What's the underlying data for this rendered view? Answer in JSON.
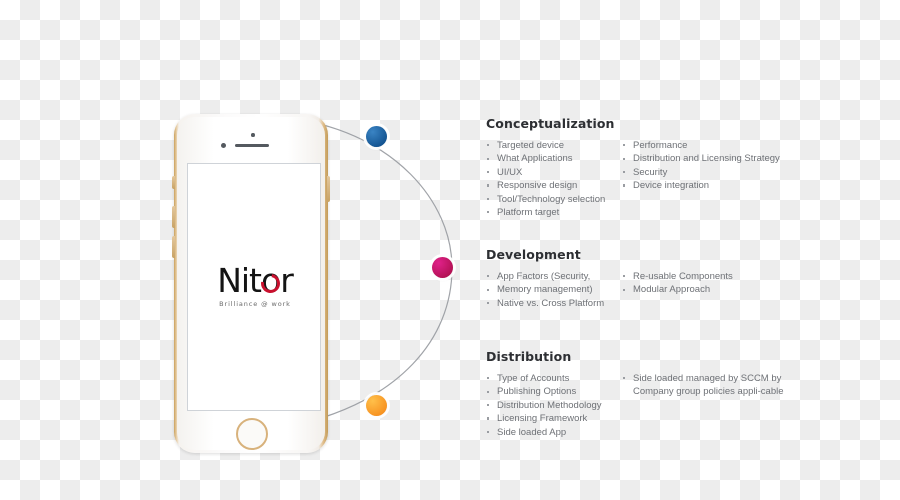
{
  "brand": {
    "logo_text_before": "Nit",
    "logo_text_o": "o",
    "logo_text_after": "r",
    "tagline": "Brilliance @ work"
  },
  "colors": {
    "dot_conceptualization": "#12528f",
    "dot_development": "#c9105e",
    "dot_distribution": "#f79420",
    "heading": "#2d2f33",
    "body_text": "#6e7176",
    "logo_accent": "#c8102e",
    "phone_frame": "#c9a05c"
  },
  "sections": [
    {
      "id": "conceptualization",
      "title": "Conceptualization",
      "left_items": [
        "Targeted device",
        "What  Applications",
        "UI/UX",
        "Responsive design",
        "Tool/Technology selection",
        "Platform target"
      ],
      "right_items": [
        "Performance",
        "Distribution and Licensing Strategy",
        "Security",
        "Device integration"
      ]
    },
    {
      "id": "development",
      "title": "Development",
      "left_items": [
        "App Factors (Security,",
        "Memory management)",
        "Native vs. Cross Platform"
      ],
      "right_items": [
        "Re-usable Components",
        "Modular Approach"
      ]
    },
    {
      "id": "distribution",
      "title": "Distribution",
      "left_items": [
        "Type of Accounts",
        "Publishing Options",
        "Distribution Methodology",
        "Licensing Framework",
        "Side loaded App"
      ],
      "right_items": [
        "Side loaded managed by SCCM by Company group policies appli-cable"
      ]
    }
  ]
}
